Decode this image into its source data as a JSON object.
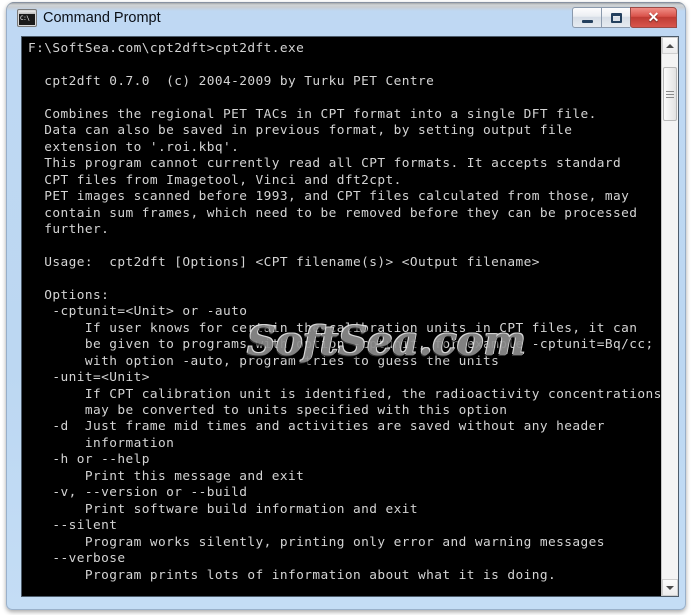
{
  "window": {
    "title": "Command Prompt",
    "icon_name": "console-icon",
    "icon_glyph": "C:\\",
    "controls": {
      "minimize_label": "Minimize",
      "maximize_label": "Maximize",
      "close_label": "✕"
    },
    "frame_color": "#bcd7f2",
    "titlebar_text_color": "#0b0f16"
  },
  "console": {
    "background_color": "#000000",
    "text_color": "#d4d4d4",
    "lines": [
      "F:\\SoftSea.com\\cpt2dft>cpt2dft.exe",
      "",
      "  cpt2dft 0.7.0  (c) 2004-2009 by Turku PET Centre",
      "",
      "  Combines the regional PET TACs in CPT format into a single DFT file.",
      "  Data can also be saved in previous format, by setting output file",
      "  extension to '.roi.kbq'.",
      "  This program cannot currently read all CPT formats. It accepts standard",
      "  CPT files from Imagetool, Vinci and dft2cpt.",
      "  PET images scanned before 1993, and CPT files calculated from those, may",
      "  contain sum frames, which need to be removed before they can be processed",
      "  further.",
      "",
      "  Usage:  cpt2dft [Options] <CPT filename(s)> <Output filename>",
      "",
      "  Options:",
      "   -cptunit=<Unit> or -auto",
      "       If user knows for certain the calibration units in CPT files, it can",
      "       be given to programs with option -cptunit, for example -cptunit=Bq/cc;",
      "       with option -auto, program tries to guess the units",
      "   -unit=<Unit>",
      "       If CPT calibration unit is identified, the radioactivity concentrations",
      "       may be converted to units specified with this option",
      "   -d  Just frame mid times and activities are saved without any header",
      "       information",
      "   -h or --help",
      "       Print this message and exit",
      "   -v, --version or --build",
      "       Print software build information and exit",
      "   --silent",
      "       Program works silently, printing only error and warning messages",
      "   --verbose",
      "       Program prints lots of information about what it is doing."
    ]
  },
  "watermark": {
    "text": "SoftSea.com",
    "color": "#8d8d8d"
  },
  "scrollbar": {
    "up_arrow_name": "scroll-up-arrow",
    "down_arrow_name": "scroll-down-arrow",
    "thumb_name": "scroll-thumb"
  }
}
